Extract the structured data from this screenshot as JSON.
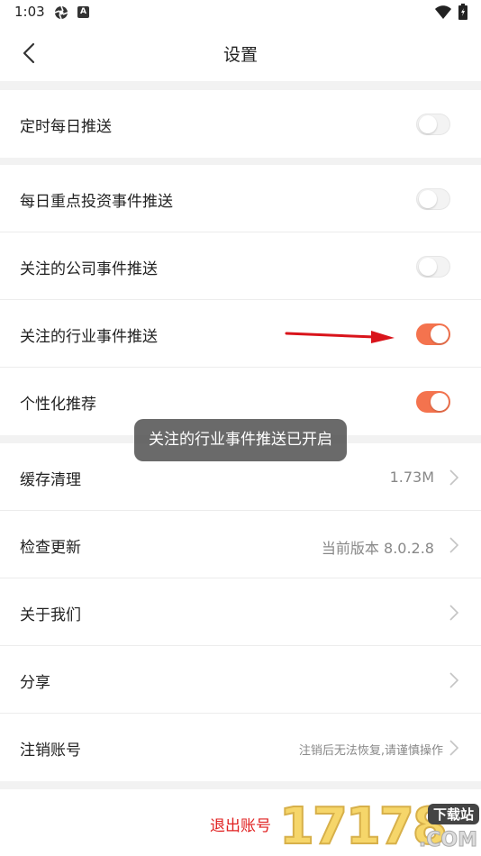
{
  "status_bar": {
    "time": "1:03",
    "app_icon2_letter": "A"
  },
  "header": {
    "title": "设置"
  },
  "settings": {
    "daily_push": {
      "label": "定时每日推送",
      "on": false
    },
    "key_events": {
      "label": "每日重点投资事件推送",
      "on": false
    },
    "company_events": {
      "label": "关注的公司事件推送",
      "on": false
    },
    "industry_events": {
      "label": "关注的行业事件推送",
      "on": true
    },
    "personalized": {
      "label": "个性化推荐",
      "on": true
    },
    "cache": {
      "label": "缓存清理",
      "value": "1.73M"
    },
    "update": {
      "label": "检查更新",
      "value": "当前版本 8.0.2.8"
    },
    "about": {
      "label": "关于我们"
    },
    "share": {
      "label": "分享"
    },
    "deregister": {
      "label": "注销账号",
      "value": "注销后无法恢复,请谨慎操作"
    }
  },
  "toast": {
    "text": "关注的行业事件推送已开启"
  },
  "logout": {
    "label": "退出账号"
  },
  "watermark": {
    "digits": "17178",
    "tag": "下载站",
    "com": ".COM"
  },
  "colors": {
    "accent": "#f4734e",
    "logout": "#e02020",
    "background": "#f2f2f2",
    "annotation_arrow": "#d9141b"
  },
  "icons": [
    "back-arrow-icon",
    "chevron-right-icon",
    "wifi-icon",
    "battery-icon",
    "status-app-icon"
  ]
}
